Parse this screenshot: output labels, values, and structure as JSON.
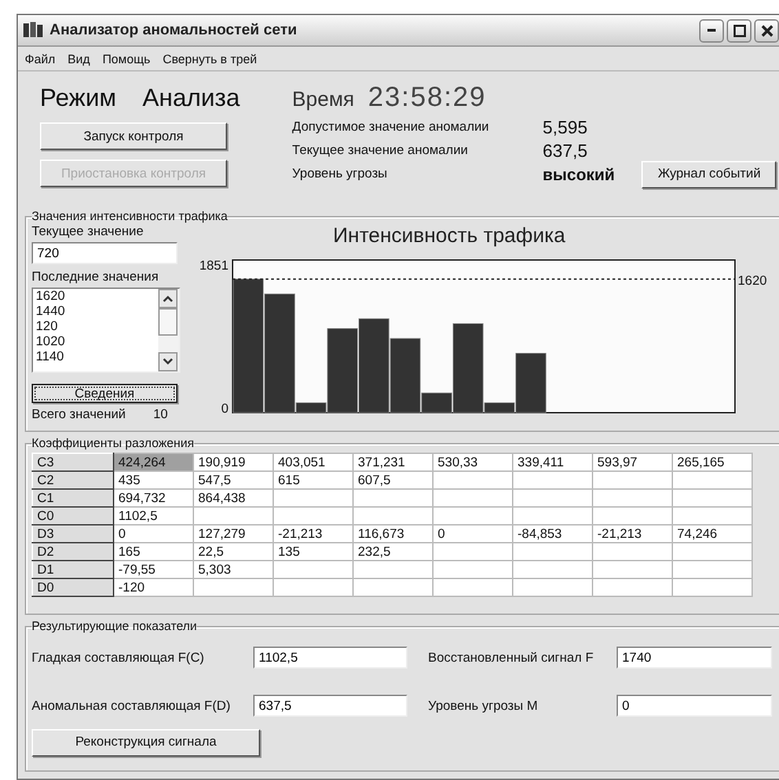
{
  "window": {
    "title": "Анализатор аномальностей сети"
  },
  "menu": [
    "Файл",
    "Вид",
    "Помощь",
    "Свернуть в трей"
  ],
  "header": {
    "mode_label": "Режим",
    "mode_value": "Анализа",
    "time_label": "Время",
    "time": "23:58:29"
  },
  "controls": [
    {
      "label": "Запуск контроля",
      "disabled": false
    },
    {
      "label": "Приостановка контроля",
      "disabled": true
    }
  ],
  "metrics": [
    {
      "label": "Допустимое значение аномалии",
      "value": "5,595"
    },
    {
      "label": "Текущее значение аномалии",
      "value": "637,5"
    },
    {
      "label": "Уровень угрозы",
      "value": "высокий"
    }
  ],
  "log_button": "Журнал событий",
  "traffic": {
    "group_title": "Значения интенсивности трафика",
    "current_label": "Текущее значение",
    "current_value": "720",
    "recent_label": "Последние значения",
    "recent_values": [
      "1620",
      "1440",
      "120",
      "1020",
      "1140"
    ],
    "details_button": "Сведения",
    "total_label": "Всего значений",
    "total": "10",
    "chart_data": {
      "type": "bar",
      "title": "Интенсивность трафика",
      "values": [
        1620,
        1440,
        120,
        1020,
        1140,
        900,
        240,
        1080,
        120,
        720,
        null,
        null,
        null,
        null,
        null,
        null
      ],
      "ylim": [
        0,
        1851
      ],
      "yticks": [
        0,
        1851
      ],
      "ref_lines": [
        {
          "axis": "y",
          "value": 1620,
          "label": "1620"
        }
      ]
    }
  },
  "coefficients": {
    "group_title": "Коэффициенты разложения",
    "rows": [
      {
        "label": "C3",
        "cells": [
          {
            "text": "424,264",
            "selected": true
          },
          {
            "text": "190,919",
            "selected": false
          },
          {
            "text": "403,051",
            "selected": false
          },
          {
            "text": "371,231",
            "selected": false
          },
          {
            "text": "530,33",
            "selected": false
          },
          {
            "text": "339,411",
            "selected": false
          },
          {
            "text": "593,97",
            "selected": false
          },
          {
            "text": "265,165",
            "selected": false
          }
        ]
      },
      {
        "label": "C2",
        "cells": [
          {
            "text": "435",
            "selected": false
          },
          {
            "text": "547,5",
            "selected": false
          },
          {
            "text": "615",
            "selected": false
          },
          {
            "text": "607,5",
            "selected": false
          }
        ]
      },
      {
        "label": "C1",
        "cells": [
          {
            "text": "694,732",
            "selected": false
          },
          {
            "text": "864,438",
            "selected": false
          }
        ]
      },
      {
        "label": "C0",
        "cells": [
          {
            "text": "1102,5",
            "selected": false
          }
        ]
      },
      {
        "label": "D3",
        "cells": [
          {
            "text": "0",
            "selected": false
          },
          {
            "text": "127,279",
            "selected": false
          },
          {
            "text": "-21,213",
            "selected": false
          },
          {
            "text": "116,673",
            "selected": false
          },
          {
            "text": "0",
            "selected": false
          },
          {
            "text": "-84,853",
            "selected": false
          },
          {
            "text": "-21,213",
            "selected": false
          },
          {
            "text": "74,246",
            "selected": false
          }
        ]
      },
      {
        "label": "D2",
        "cells": [
          {
            "text": "165",
            "selected": false
          },
          {
            "text": "22,5",
            "selected": false
          },
          {
            "text": "135",
            "selected": false
          },
          {
            "text": "232,5",
            "selected": false
          }
        ]
      },
      {
        "label": "D1",
        "cells": [
          {
            "text": "-79,55",
            "selected": false
          },
          {
            "text": "5,303",
            "selected": false
          }
        ]
      },
      {
        "label": "D0",
        "cells": [
          {
            "text": "-120",
            "selected": false
          }
        ]
      }
    ]
  },
  "results": {
    "group_title": "Результирующие показатели",
    "fields": [
      {
        "label": "Гладкая составляющая F(C)",
        "value": "1102,5"
      },
      {
        "label": "Восстановленный сигнал F",
        "value": "1740"
      },
      {
        "label": "Аномальная составляющая F(D)",
        "value": "637,5"
      },
      {
        "label": "Уровень угрозы M",
        "value": "0"
      }
    ],
    "button": "Реконструкция сигнала"
  }
}
